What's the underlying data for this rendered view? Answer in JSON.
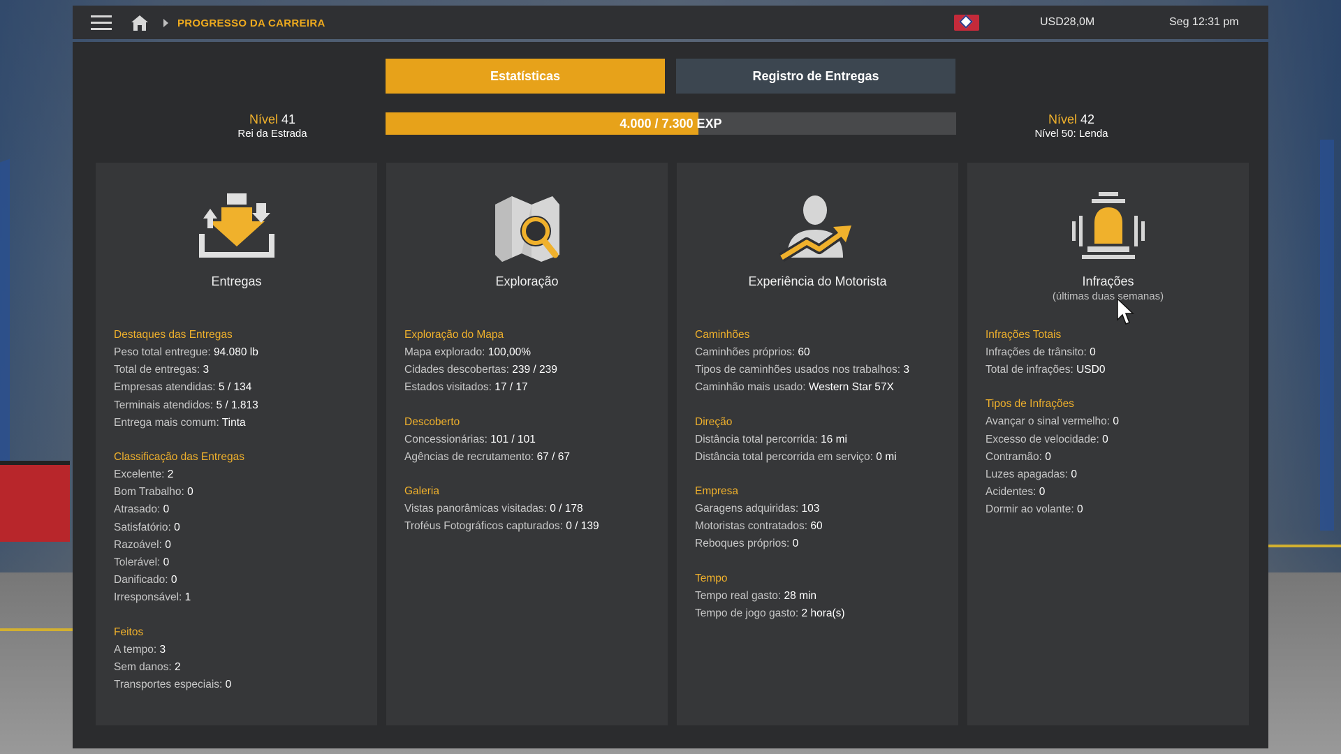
{
  "topbar": {
    "breadcrumb": "PROGRESSO DA CARREIRA",
    "money": "USD28,0M",
    "clock": "Seg 12:31 pm",
    "icons": [
      "menu-icon",
      "home-icon",
      "flag-icon"
    ]
  },
  "tabs": {
    "stats": "Estatísticas",
    "log": "Registro de Entregas",
    "active": "stats"
  },
  "level": {
    "left": {
      "word": "Nível",
      "num": "41",
      "sub": "Rei da Estrada"
    },
    "right": {
      "word": "Nível",
      "num": "42",
      "sub": "Nível 50: Lenda"
    },
    "exp_text": "4.000 / 7.300",
    "exp_unit": "EXP",
    "progress": 0.548
  },
  "cards": [
    {
      "title": "Entregas",
      "note": "",
      "icon": "delivery-icon",
      "sections": [
        {
          "title": "Destaques das Entregas",
          "rows": [
            {
              "label": "Peso total entregue: ",
              "value": "94.080 lb"
            },
            {
              "label": "Total de entregas: ",
              "value": "3"
            },
            {
              "label": "Empresas atendidas: ",
              "value": "5 / 134"
            },
            {
              "label": "Terminais atendidos: ",
              "value": "5 / 1.813"
            },
            {
              "label": "Entrega mais comum: ",
              "value": "Tinta"
            }
          ]
        },
        {
          "title": "Classificação das Entregas",
          "rows": [
            {
              "label": "Excelente: ",
              "value": "2"
            },
            {
              "label": "Bom Trabalho: ",
              "value": "0"
            },
            {
              "label": "Atrasado: ",
              "value": "0"
            },
            {
              "label": "Satisfatório: ",
              "value": "0"
            },
            {
              "label": "Razoável: ",
              "value": "0"
            },
            {
              "label": "Tolerável: ",
              "value": "0"
            },
            {
              "label": "Danificado: ",
              "value": "0"
            },
            {
              "label": "Irresponsável: ",
              "value": "1"
            }
          ]
        },
        {
          "title": "Feitos",
          "rows": [
            {
              "label": "A tempo: ",
              "value": "3"
            },
            {
              "label": "Sem danos: ",
              "value": "2"
            },
            {
              "label": "Transportes especiais: ",
              "value": "0"
            }
          ]
        }
      ]
    },
    {
      "title": "Exploração",
      "note": "",
      "icon": "map-search-icon",
      "sections": [
        {
          "title": "Exploração do Mapa",
          "rows": [
            {
              "label": "Mapa explorado: ",
              "value": "100,00%"
            },
            {
              "label": "Cidades descobertas: ",
              "value": "239 / 239"
            },
            {
              "label": "Estados visitados: ",
              "value": "17 / 17"
            }
          ]
        },
        {
          "title": "Descoberto",
          "rows": [
            {
              "label": "Concessionárias: ",
              "value": "101 / 101"
            },
            {
              "label": "Agências de recrutamento: ",
              "value": "67 / 67"
            }
          ]
        },
        {
          "title": "Galeria",
          "rows": [
            {
              "label": "Vistas panorâmicas visitadas: ",
              "value": "0 / 178"
            },
            {
              "label": "Troféus Fotográficos capturados: ",
              "value": "0 / 139"
            }
          ]
        }
      ]
    },
    {
      "title": "Experiência do Motorista",
      "note": "",
      "icon": "driver-growth-icon",
      "sections": [
        {
          "title": "Caminhões",
          "rows": [
            {
              "label": "Caminhões próprios: ",
              "value": "60"
            },
            {
              "label": "Tipos de caminhões usados nos trabalhos: ",
              "value": "3"
            },
            {
              "label": "Caminhão mais usado: ",
              "value": "Western Star 57X"
            }
          ]
        },
        {
          "title": "Direção",
          "rows": [
            {
              "label": "Distância total percorrida: ",
              "value": "16 mi"
            },
            {
              "label": "Distância total percorrida em serviço: ",
              "value": "0 mi"
            }
          ]
        },
        {
          "title": "Empresa",
          "rows": [
            {
              "label": "Garagens adquiridas: ",
              "value": "103"
            },
            {
              "label": "Motoristas contratados: ",
              "value": "60"
            },
            {
              "label": "Reboques próprios: ",
              "value": "0"
            }
          ]
        },
        {
          "title": "Tempo",
          "rows": [
            {
              "label": "Tempo real gasto: ",
              "value": "28 min"
            },
            {
              "label": "Tempo de jogo gasto: ",
              "value": "2 hora(s)"
            }
          ]
        }
      ]
    },
    {
      "title": "Infrações",
      "note": "(últimas duas semanas)",
      "icon": "siren-icon",
      "sections": [
        {
          "title": "Infrações Totais",
          "rows": [
            {
              "label": "Infrações de trânsito: ",
              "value": "0"
            },
            {
              "label": "Total de infrações: ",
              "value": "USD0"
            }
          ]
        },
        {
          "title": "Tipos de Infrações",
          "rows": [
            {
              "label": "Avançar o sinal vermelho: ",
              "value": "0"
            },
            {
              "label": "Excesso de velocidade: ",
              "value": "0"
            },
            {
              "label": "Contramão: ",
              "value": "0"
            },
            {
              "label": "Luzes apagadas: ",
              "value": "0"
            },
            {
              "label": "Acidentes: ",
              "value": "0"
            },
            {
              "label": "Dormir ao volante: ",
              "value": "0"
            }
          ]
        }
      ]
    }
  ],
  "colors": {
    "accent": "#e7a21a",
    "section_title": "#f0b12c",
    "panel": "#2b2c2e",
    "card": "#363739",
    "tab_inactive": "#3c4650"
  }
}
